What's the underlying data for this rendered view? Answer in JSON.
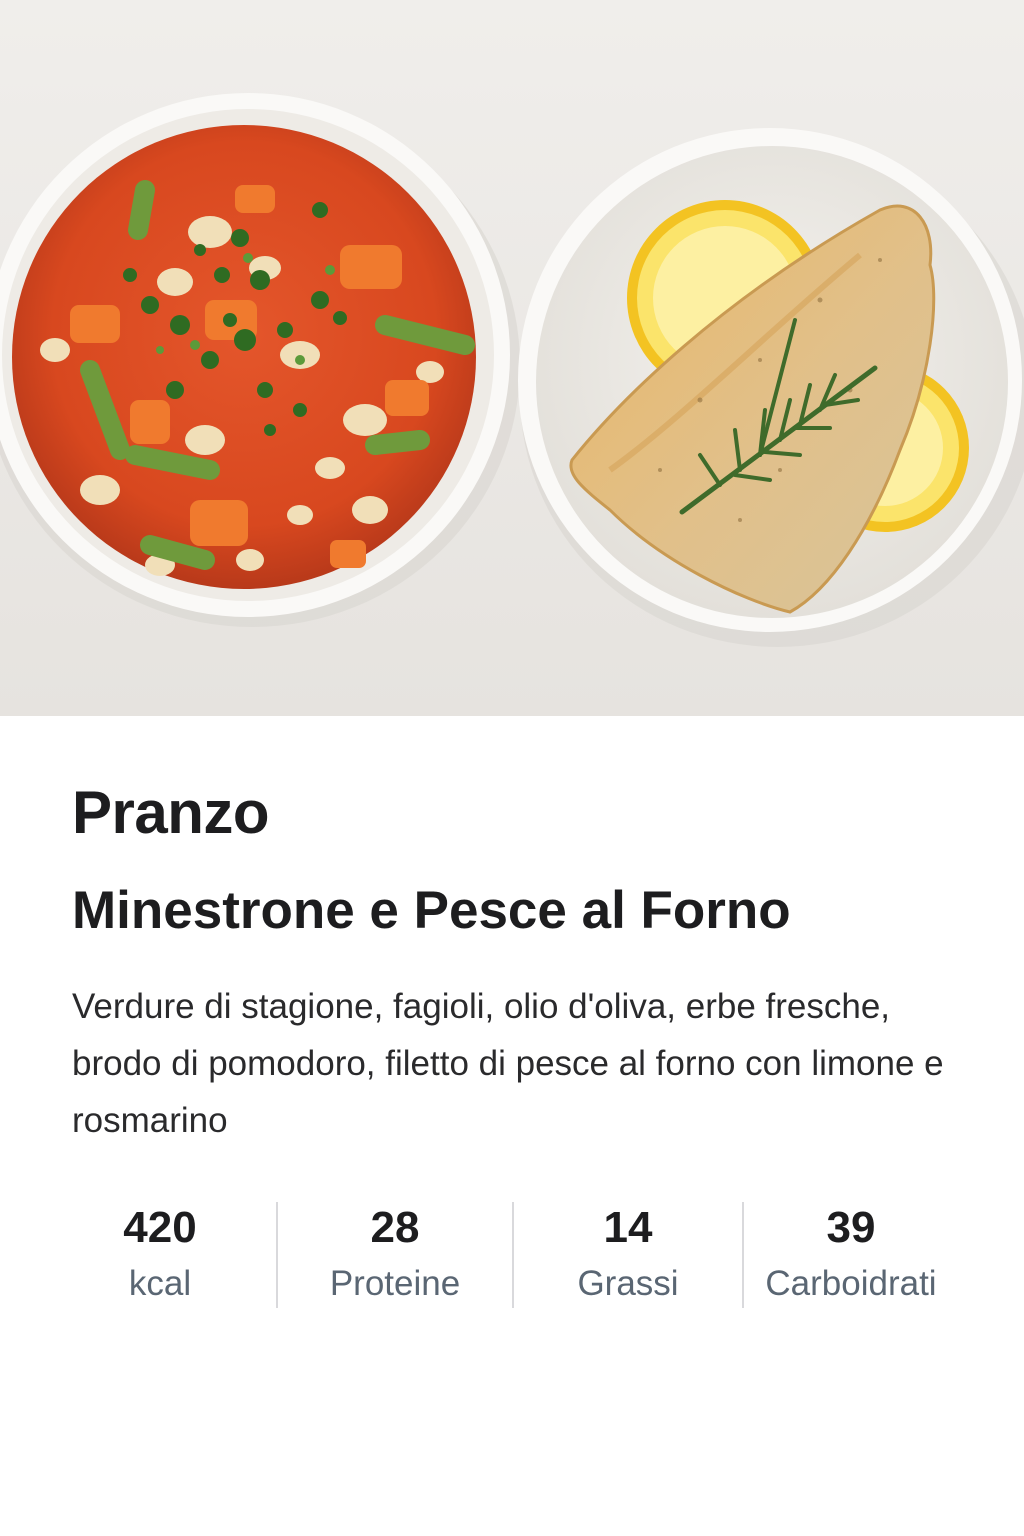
{
  "meal": {
    "label": "Pranzo",
    "title": "Minestrone e Pesce al Forno",
    "description": "Verdure di stagione, fagioli, olio d'oliva, erbe fresche, brodo di pomodoro, filetto di pesce al forno con limone e rosmarino"
  },
  "nutrition": [
    {
      "value": "420",
      "label": "kcal"
    },
    {
      "value": "28",
      "label": "Proteine"
    },
    {
      "value": "14",
      "label": "Grassi"
    },
    {
      "value": "39",
      "label": "Carboidrati"
    }
  ],
  "colors": {
    "title_text": "#1d1d1f",
    "label_text": "#5a6673",
    "divider": "#d9d9dc",
    "photo_background": "#edebe8"
  }
}
